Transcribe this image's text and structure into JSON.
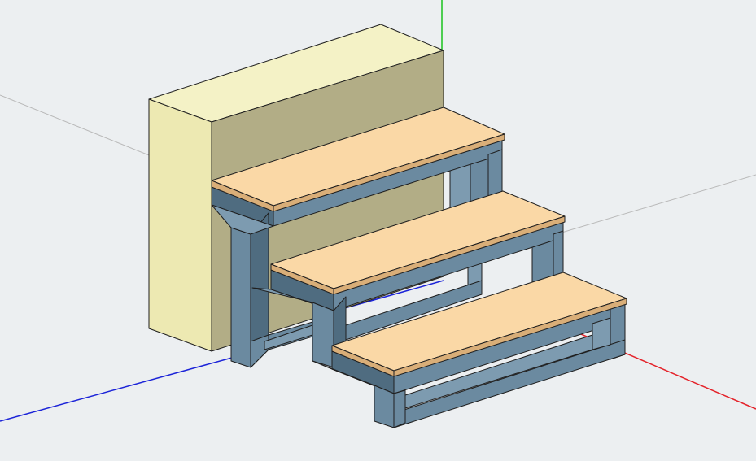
{
  "viewport": {
    "background_color": "#eceff1",
    "axes": {
      "x_axis_color": "#e4222a",
      "y_axis_color": "#19c31d",
      "z_axis_color": "#1b23d8",
      "guide_color": "#b9b9b9"
    },
    "colors": {
      "wall_front": "#ede9b2",
      "wall_top": "#f4f2c6",
      "wall_right": "#b2ad86",
      "tread_top": "#fad8a6",
      "tread_edge": "#d9ae78",
      "frame_front": "#6b8aa0",
      "frame_dark": "#4f6c80",
      "frame_light": "#7d9bb0"
    }
  }
}
